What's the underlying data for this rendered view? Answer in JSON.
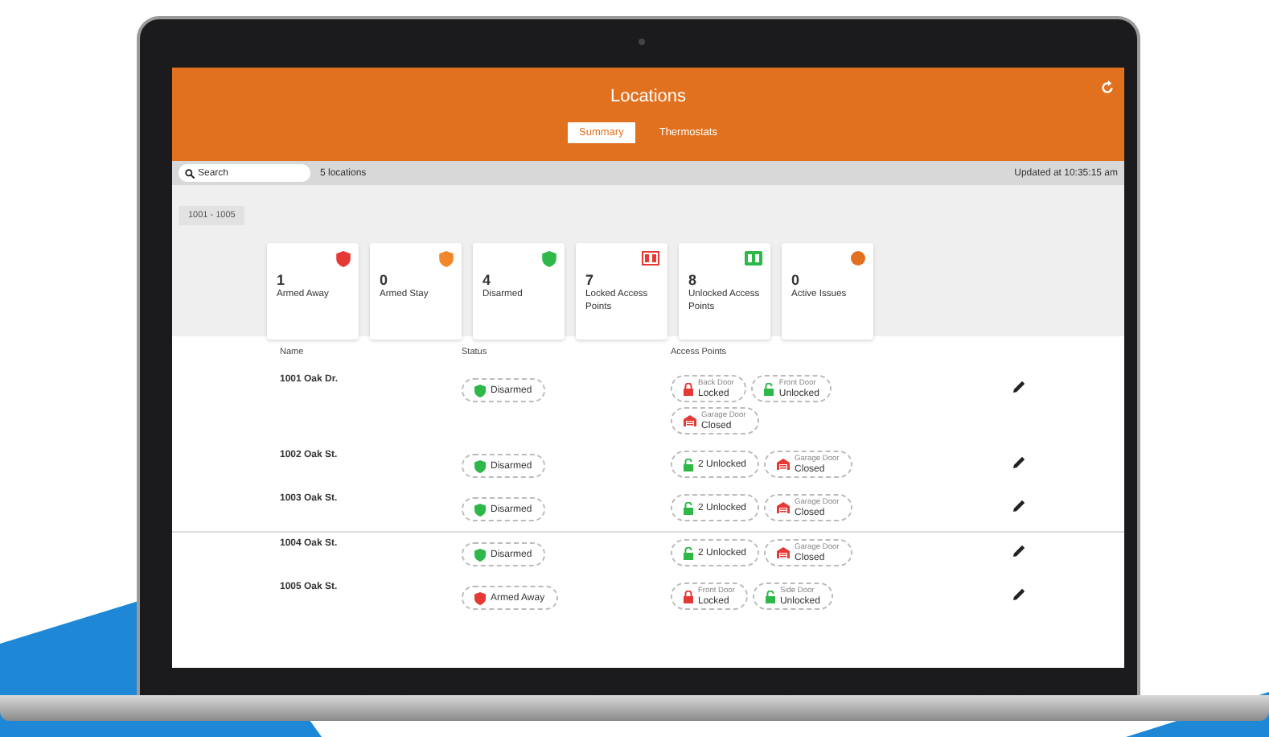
{
  "header": {
    "title": "Locations",
    "tabs": [
      {
        "label": "Summary",
        "selected": true
      },
      {
        "label": "Thermostats",
        "selected": false
      }
    ]
  },
  "toolbar": {
    "search": {
      "placeholder": "Search"
    },
    "count": "5 locations",
    "updated": "Updated at 10:35:15 am"
  },
  "filter_chip": "1001 - 1005",
  "summary_cards": [
    {
      "kind": "armed_away",
      "count": "1",
      "label": "Armed Away"
    },
    {
      "kind": "armed_stay",
      "count": "0",
      "label": "Armed Stay"
    },
    {
      "kind": "disarmed",
      "count": "4",
      "label": "Disarmed"
    },
    {
      "kind": "locked",
      "count": "7",
      "label": "Locked Access Points"
    },
    {
      "kind": "unlocked",
      "count": "8",
      "label": "Unlocked Access Points"
    },
    {
      "kind": "issues",
      "count": "0",
      "label": "Active Issues"
    }
  ],
  "table": {
    "columns": [
      "Name",
      "Status",
      "Access Points"
    ],
    "rows": [
      {
        "name": "1001 Oak Dr.",
        "status": {
          "kind": "disarmed",
          "label": "Disarmed"
        },
        "access_points": [
          {
            "kind": "locked",
            "name": "Back Door",
            "state": "Locked"
          },
          {
            "kind": "unlocked",
            "name": "Front Door",
            "state": "Unlocked"
          },
          {
            "kind": "garage_closed",
            "name": "Garage Door",
            "state": "Closed"
          }
        ]
      },
      {
        "name": "1002 Oak St.",
        "status": {
          "kind": "disarmed",
          "label": "Disarmed"
        },
        "access_points": [
          {
            "kind": "unlocked",
            "state": "2 Unlocked"
          },
          {
            "kind": "garage_closed",
            "name": "Garage Door",
            "state": "Closed"
          }
        ]
      },
      {
        "name": "1003 Oak St.",
        "status": {
          "kind": "disarmed",
          "label": "Disarmed"
        },
        "access_points": [
          {
            "kind": "unlocked",
            "state": "2 Unlocked"
          },
          {
            "kind": "garage_closed",
            "name": "Garage Door",
            "state": "Closed"
          }
        ]
      },
      {
        "name": "1004 Oak St.",
        "status": {
          "kind": "disarmed",
          "label": "Disarmed"
        },
        "access_points": [
          {
            "kind": "unlocked",
            "state": "2 Unlocked"
          },
          {
            "kind": "garage_closed",
            "name": "Garage Door",
            "state": "Closed"
          }
        ]
      },
      {
        "name": "1005 Oak St.",
        "status": {
          "kind": "armed_away",
          "label": "Armed Away"
        },
        "access_points": [
          {
            "kind": "locked",
            "name": "Front Door",
            "state": "Locked"
          },
          {
            "kind": "unlocked",
            "name": "Side Door",
            "state": "Unlocked"
          }
        ]
      }
    ]
  }
}
